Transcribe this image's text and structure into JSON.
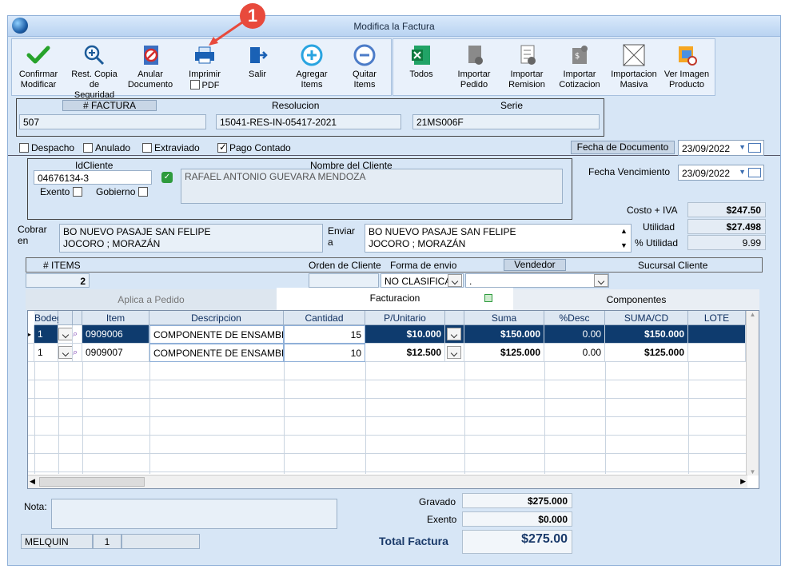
{
  "window": {
    "title": "Modifica la Factura"
  },
  "annotation": {
    "number": "1"
  },
  "toolbar": {
    "confirmar": [
      "Confirmar",
      "Modificar"
    ],
    "rest_copia": [
      "Rest. Copia",
      "de Seguridad"
    ],
    "anular": [
      "Anular",
      "Documento"
    ],
    "imprimir": "Imprimir",
    "pdf_label": "PDF",
    "salir": "Salir",
    "agregar": [
      "Agregar",
      "Items"
    ],
    "quitar": [
      "Quitar",
      "Items"
    ],
    "todos": "Todos",
    "importar_pedido": [
      "Importar",
      "Pedido"
    ],
    "importar_remision": [
      "Importar",
      "Remision"
    ],
    "importar_cotizacion": [
      "Importar",
      "Cotizacion"
    ],
    "importacion_masiva": [
      "Importacion",
      "Masiva"
    ],
    "ver_imagen": [
      "Ver Imagen",
      "Producto"
    ]
  },
  "header": {
    "factura_label": "# FACTURA",
    "factura_value": "507",
    "resolucion_label": "Resolucion",
    "resolucion_value": "15041-RES-IN-05417-2021",
    "serie_label": "Serie",
    "serie_value": "21MS006F"
  },
  "flags": {
    "despacho": "Despacho",
    "anulado": "Anulado",
    "extraviado": "Extraviado",
    "pago_contado": "Pago Contado",
    "pago_contado_checked": true
  },
  "fechas": {
    "documento_label": "Fecha de Documento",
    "documento_value": "23/09/2022",
    "vencimiento_label": "Fecha Vencimiento",
    "vencimiento_value": "23/09/2022"
  },
  "cliente": {
    "id_label": "IdCliente",
    "id_value": "04676134-3",
    "nombre_label": "Nombre del Cliente",
    "nombre_value": "RAFAEL ANTONIO GUEVARA MENDOZA",
    "exento": "Exento",
    "gobierno": "Gobierno"
  },
  "costos": {
    "costo_iva_label": "Costo + IVA",
    "costo_iva_value": "$247.50",
    "utilidad_label": "Utilidad",
    "utilidad_value": "$27.498",
    "pct_utilidad_label": "% Utilidad",
    "pct_utilidad_value": "9.99"
  },
  "direcciones": {
    "cobrar_label": "Cobrar en",
    "cobrar_line1": "BO NUEVO PASAJE SAN FELIPE",
    "cobrar_line2": "JOCORO ; MORAZÁN",
    "enviar_label": "Enviar a",
    "enviar_line1": "BO NUEVO PASAJE SAN FELIPE",
    "enviar_line2": "JOCORO ; MORAZÁN"
  },
  "info_row": {
    "items_label": "# ITEMS",
    "items_value": "2",
    "orden_label": "Orden de Cliente",
    "forma_label": "Forma de envio",
    "forma_value": "NO CLASIFICA",
    "vendedor_label": "Vendedor",
    "vendedor_value": ".",
    "sucursal_label": "Sucursal Cliente"
  },
  "tabs": [
    "Aplica a Pedido",
    "Facturacion",
    "Componentes"
  ],
  "grid": {
    "columns": [
      "Bodega",
      "",
      "",
      "Item",
      "Descripcion",
      "Cantidad",
      "P/Unitario",
      "",
      "Suma",
      "%Desc",
      "SUMA/CD",
      "LOTE"
    ],
    "rows": [
      {
        "bodega": "1",
        "item": "0909006",
        "descripcion": "COMPONENTE DE ENSAMBL",
        "cantidad": "15",
        "punitario": "$10.000",
        "suma": "$150.000",
        "desc": "0.00",
        "sumacd": "$150.000"
      },
      {
        "bodega": "1",
        "item": "0909007",
        "descripcion": "COMPONENTE DE ENSAMBL",
        "cantidad": "10",
        "punitario": "$12.500",
        "suma": "$125.000",
        "desc": "0.00",
        "sumacd": "$125.000"
      }
    ]
  },
  "footer": {
    "nota_label": "Nota:",
    "gravado_label": "Gravado",
    "gravado_value": "$275.000",
    "exento_label": "Exento",
    "exento_value": "$0.000",
    "total_label": "Total Factura",
    "total_value": "$275.00",
    "user": "MELQUIN",
    "user_num": "1"
  },
  "colors": {
    "accent": "#0e3b6e",
    "window_bg": "#d7e6f6",
    "annotation": "#e84a3c"
  }
}
